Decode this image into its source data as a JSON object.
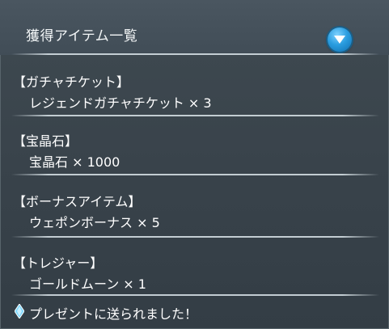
{
  "header": {
    "title": "獲得アイテム一覧",
    "dropdown_icon": "triangle-down-icon"
  },
  "sections": [
    {
      "category": "【ガチャチケット】",
      "item": "レジェンドガチャチケット × 3"
    },
    {
      "category": "【宝晶石】",
      "item": "宝晶石 × 1000"
    },
    {
      "category": "【ボーナスアイテム】",
      "item": "ウェポンボーナス × 5"
    },
    {
      "category": "【トレジャー】",
      "item": "ゴールドムーン × 1"
    }
  ],
  "footer": {
    "message": "プレゼントに送られました！",
    "icon": "crystal-icon"
  },
  "colors": {
    "accent": "#2a9de0",
    "panel": "#3a444c",
    "text": "#ffffff"
  }
}
